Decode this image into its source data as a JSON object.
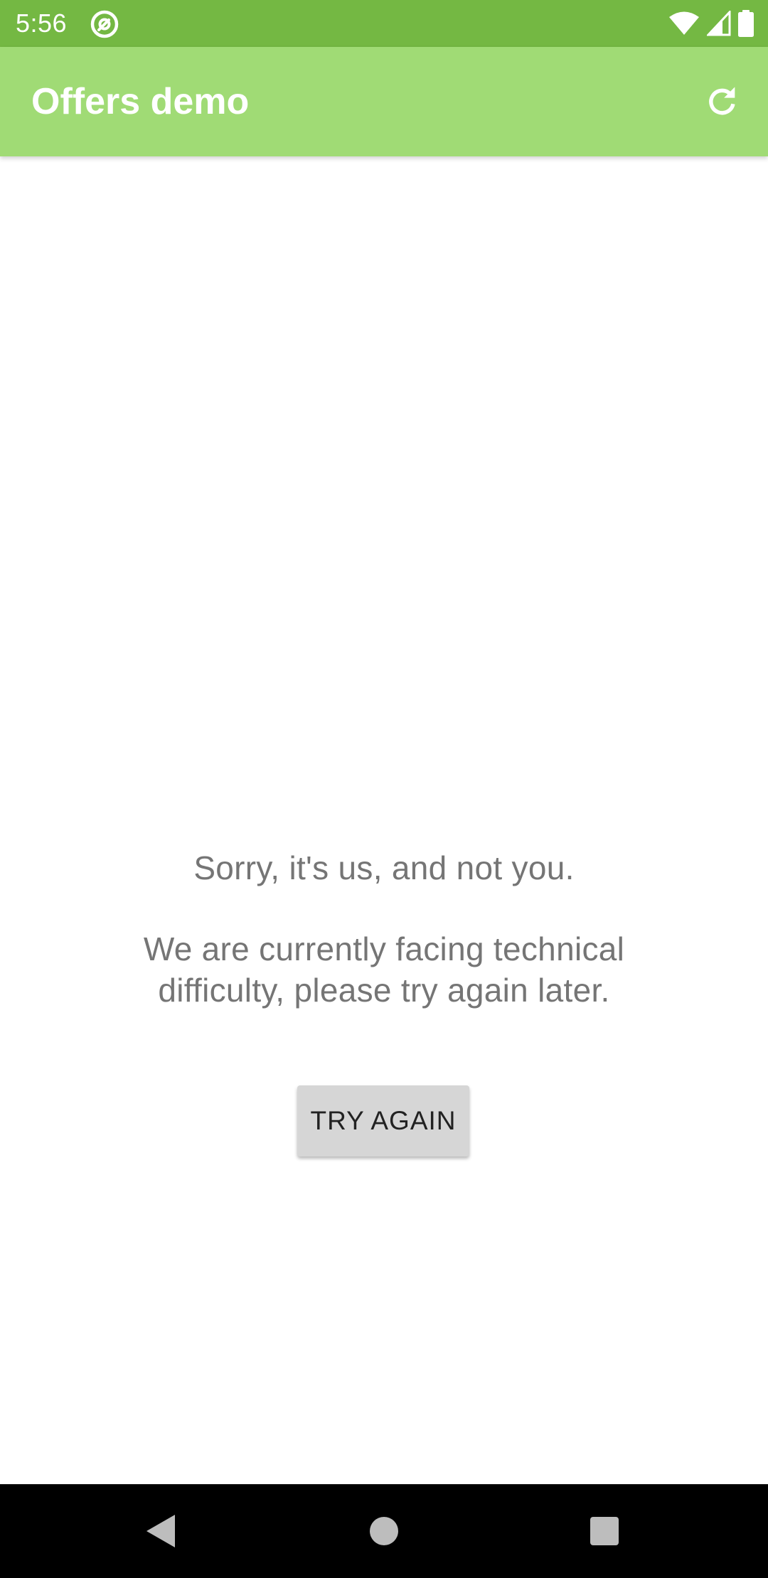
{
  "status_bar": {
    "time": "5:56",
    "icons": [
      "at-sign-app-icon",
      "wifi-icon",
      "cell-signal-icon",
      "battery-icon"
    ]
  },
  "app_bar": {
    "title": "Offers demo",
    "action_icon": "refresh-icon"
  },
  "error": {
    "line1": "Sorry, it's us, and not you.",
    "line2": "We are currently facing technical difficulty, please try again later."
  },
  "retry_button": {
    "label": "TRY AGAIN"
  },
  "nav_bar": {
    "icons": [
      "back-icon",
      "home-icon",
      "recents-icon"
    ]
  },
  "colors": {
    "status_bar": "#74b843",
    "app_bar": "#a0db75",
    "message_text": "#757575",
    "button_bg": "#d6d6d6"
  }
}
